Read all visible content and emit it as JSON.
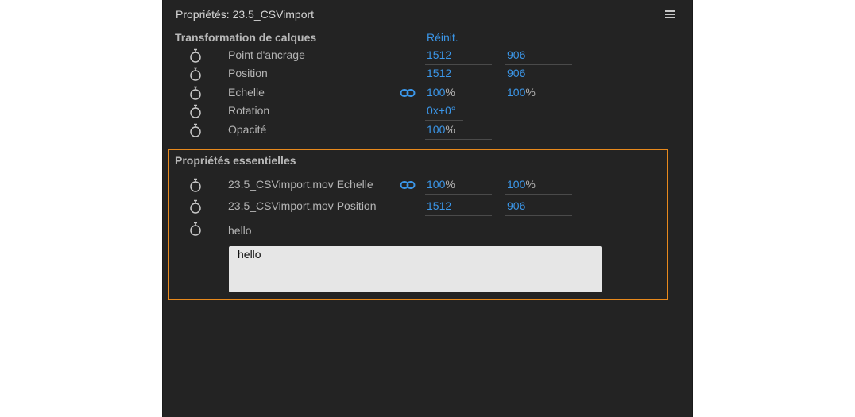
{
  "panel": {
    "title": "Propriétés: 23.5_CSVimport"
  },
  "transform": {
    "heading": "Transformation de calques",
    "reset_label": "Réinit.",
    "rows": {
      "anchor": {
        "label": "Point d'ancrage",
        "x": "1512",
        "y": "906"
      },
      "position": {
        "label": "Position",
        "x": "1512",
        "y": "906"
      },
      "scale": {
        "label": "Echelle",
        "x": "100",
        "y": "100",
        "unit": "%"
      },
      "rotation": {
        "label": "Rotation",
        "value": "0x+0°"
      },
      "opacity": {
        "label": "Opacité",
        "value": "100",
        "unit": "%"
      }
    }
  },
  "essential": {
    "heading": "Propriétés essentielles",
    "scale": {
      "label": "23.5_CSVimport.mov Echelle",
      "x": "100",
      "y": "100",
      "unit": "%"
    },
    "position": {
      "label": "23.5_CSVimport.mov Position",
      "x": "1512",
      "y": "906"
    },
    "text": {
      "label": "hello",
      "value": "hello"
    }
  },
  "colors": {
    "accent": "#3b96e8",
    "highlight_border": "#e8891c",
    "panel_bg": "#232323"
  },
  "icons": [
    "panel-menu-icon",
    "stopwatch-icon",
    "link-icon"
  ]
}
